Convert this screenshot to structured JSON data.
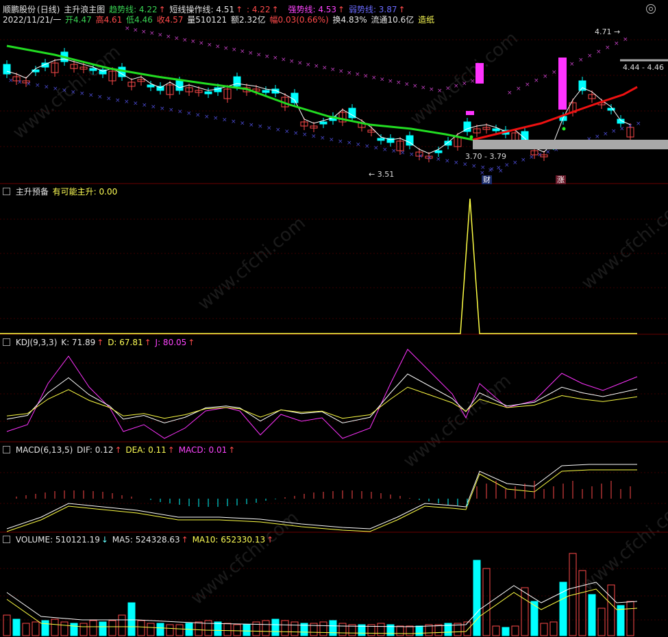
{
  "header": {
    "stock_name": "顺鹏股份",
    "period": "(日线)",
    "indicator_name": "主升浪主图",
    "trend_label": "趋势线: 4.22",
    "short_label": "短线操作线: 4.51",
    "short_val2": ": 4.22",
    "strong_label": "强势线: 4.53",
    "weak_label": "弱势线: 3.87",
    "date": "2022/11/21/一",
    "open": "开4.47",
    "high": "高4.61",
    "low": "低4.46",
    "close": "收4.57",
    "volume": "量510121",
    "amount": "额2.32亿",
    "change": "幅0.03(0.66%)",
    "turnover": "换4.83%",
    "float": "流通10.6亿",
    "sector": "造纸"
  },
  "main_annotations": {
    "high_price": "4.71",
    "low_price": "3.51",
    "support_range": "3.70 - 3.79",
    "resist_range": "4.44 - 4.46",
    "tag_cai": "财",
    "tag_zhang": "涨"
  },
  "panels": {
    "p2_title": "主升预备",
    "p2_value": "有可能主升: 0.00",
    "kdj_title": "KDJ(9,3,3)",
    "kdj_k": "K: 71.89",
    "kdj_d": "D: 67.81",
    "kdj_j": "J: 80.05",
    "macd_title": "MACD(6,13,5)",
    "macd_dif": "DIF: 0.12",
    "macd_dea": "DEA: 0.11",
    "macd_macd": "MACD: 0.01",
    "vol_title": "VOLUME: 510121.19",
    "vol_ma5": "MA5: 524328.63",
    "vol_ma10": "MA10: 652330.13"
  },
  "watermark": "www.cfchi.com",
  "colors": {
    "up": "#ff4a4a",
    "down": "#00ffff",
    "trend_green": "#22dd22",
    "strong_red": "#ee1111",
    "magenta": "#ff33ff",
    "yellow": "#ffff44",
    "grid": "#3a0000"
  }
}
